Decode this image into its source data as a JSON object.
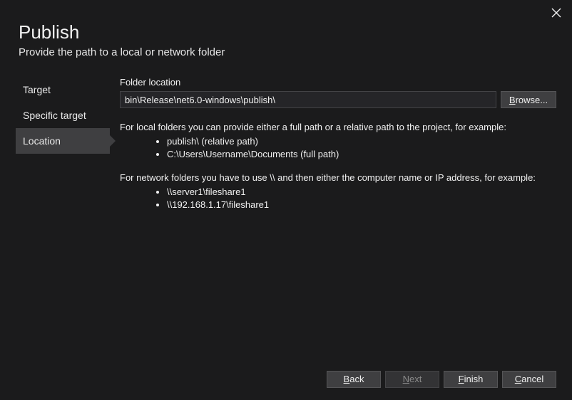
{
  "header": {
    "title": "Publish",
    "subtitle": "Provide the path to a local or network folder"
  },
  "sidebar": {
    "items": [
      {
        "label": "Target",
        "active": false
      },
      {
        "label": "Specific target",
        "active": false
      },
      {
        "label": "Location",
        "active": true
      }
    ]
  },
  "main": {
    "folder_label": "Folder location",
    "folder_value": "bin\\Release\\net6.0-windows\\publish\\",
    "browse_label": "Browse...",
    "help": {
      "local_intro": "For local folders you can provide either a full path or a relative path to the project, for example:",
      "local_examples": [
        "publish\\ (relative path)",
        "C:\\Users\\Username\\Documents (full path)"
      ],
      "network_intro": "For network folders you have to use \\\\ and then either the computer name or IP address, for example:",
      "network_examples": [
        "\\\\server1\\fileshare1",
        "\\\\192.168.1.17\\fileshare1"
      ]
    }
  },
  "footer": {
    "back": "Back",
    "next": "Next",
    "finish": "Finish",
    "cancel": "Cancel"
  }
}
